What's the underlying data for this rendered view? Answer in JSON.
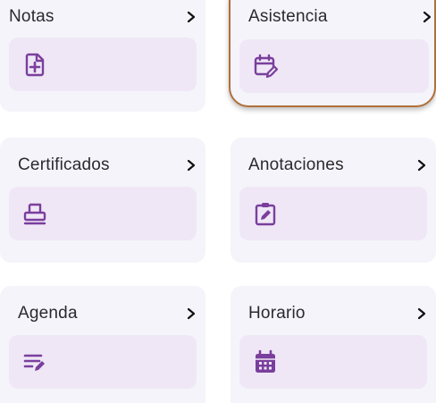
{
  "tiles": [
    {
      "label": "Notas",
      "icon": "file-plus-icon"
    },
    {
      "label": "Asistencia",
      "icon": "calendar-edit-icon",
      "selected": true
    },
    {
      "label": "Certificados",
      "icon": "printer-icon"
    },
    {
      "label": "Anotaciones",
      "icon": "clipboard-edit-icon"
    },
    {
      "label": "Agenda",
      "icon": "list-edit-icon"
    },
    {
      "label": "Horario",
      "icon": "calendar-grid-icon"
    }
  ],
  "colors": {
    "card_bg": "#f5f4fa",
    "icon_tile_bg": "#efe7f6",
    "icon": "#7a3f9d",
    "text": "#2a2a2e",
    "focus_border": "#b0703a"
  }
}
